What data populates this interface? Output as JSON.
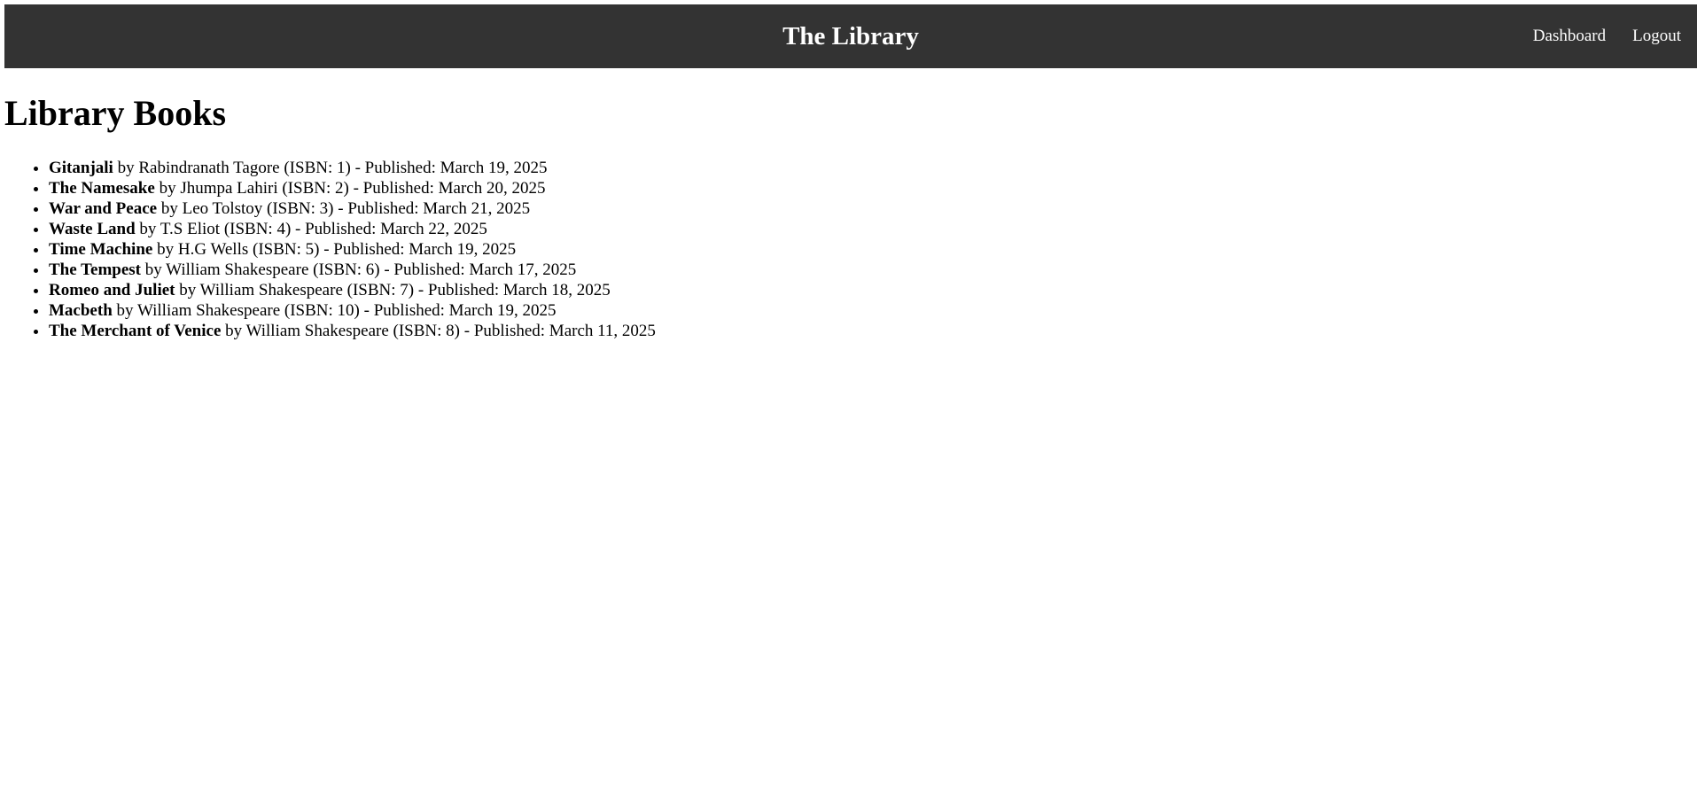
{
  "header": {
    "title": "The Library",
    "nav": [
      {
        "label": "Dashboard"
      },
      {
        "label": "Logout"
      }
    ]
  },
  "main": {
    "heading": "Library Books",
    "connector": "by",
    "books": [
      {
        "title": "Gitanjali",
        "author": "Rabindranath Tagore",
        "details": "(ISBN: 1) - Published: March 19, 2025"
      },
      {
        "title": "The Namesake",
        "author": "Jhumpa Lahiri",
        "details": "(ISBN: 2) - Published: March 20, 2025"
      },
      {
        "title": "War and Peace",
        "author": "Leo Tolstoy",
        "details": "(ISBN: 3) - Published: March 21, 2025"
      },
      {
        "title": "Waste Land",
        "author": "T.S Eliot",
        "details": "(ISBN: 4) - Published: March 22, 2025"
      },
      {
        "title": "Time Machine",
        "author": "H.G Wells",
        "details": "(ISBN: 5) - Published: March 19, 2025"
      },
      {
        "title": "The Tempest",
        "author": "William Shakespeare",
        "details": "(ISBN: 6) - Published: March 17, 2025"
      },
      {
        "title": "Romeo and Juliet",
        "author": "William Shakespeare",
        "details": "(ISBN: 7) - Published: March 18, 2025"
      },
      {
        "title": "Macbeth",
        "author": "William Shakespeare",
        "details": "(ISBN: 10) - Published: March 19, 2025"
      },
      {
        "title": "The Merchant of Venice",
        "author": "William Shakespeare",
        "details": "(ISBN: 8) - Published: March 11, 2025"
      }
    ]
  },
  "colors": {
    "navbar_bg": "#333333",
    "nav_text": "#ffffff",
    "body_text": "#000000"
  }
}
